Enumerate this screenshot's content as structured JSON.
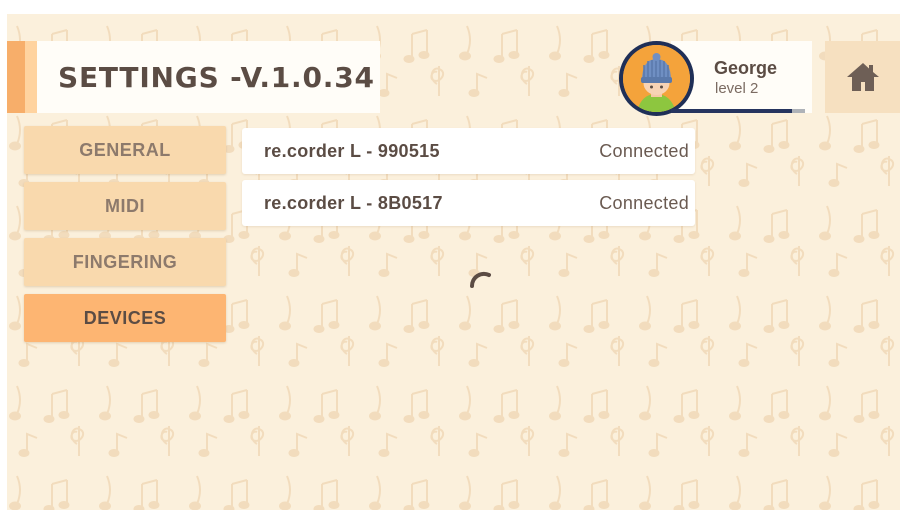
{
  "header": {
    "title": "SETTINGS -V.1.0.34"
  },
  "profile": {
    "name": "George",
    "level_label": "level 2",
    "xp_progress": 0.9,
    "avatar_icon": "avatar-beanie-icon"
  },
  "home": {
    "icon": "home-icon"
  },
  "sidebar": {
    "tabs": [
      {
        "label": "GENERAL"
      },
      {
        "label": "MIDI"
      },
      {
        "label": "FINGERING"
      },
      {
        "label": "DEVICES"
      }
    ],
    "active_tab": "DEVICES"
  },
  "devices": [
    {
      "name": "re.corder L - 990515",
      "status": "Connected"
    },
    {
      "name": "re.corder L - 8B0517",
      "status": "Connected"
    }
  ],
  "colors": {
    "background": "#fbf0dc",
    "accent": "#fdb572",
    "tab": "#f9d9ad",
    "text": "#5b4c44",
    "avatar_ring": "#1f2f57"
  }
}
